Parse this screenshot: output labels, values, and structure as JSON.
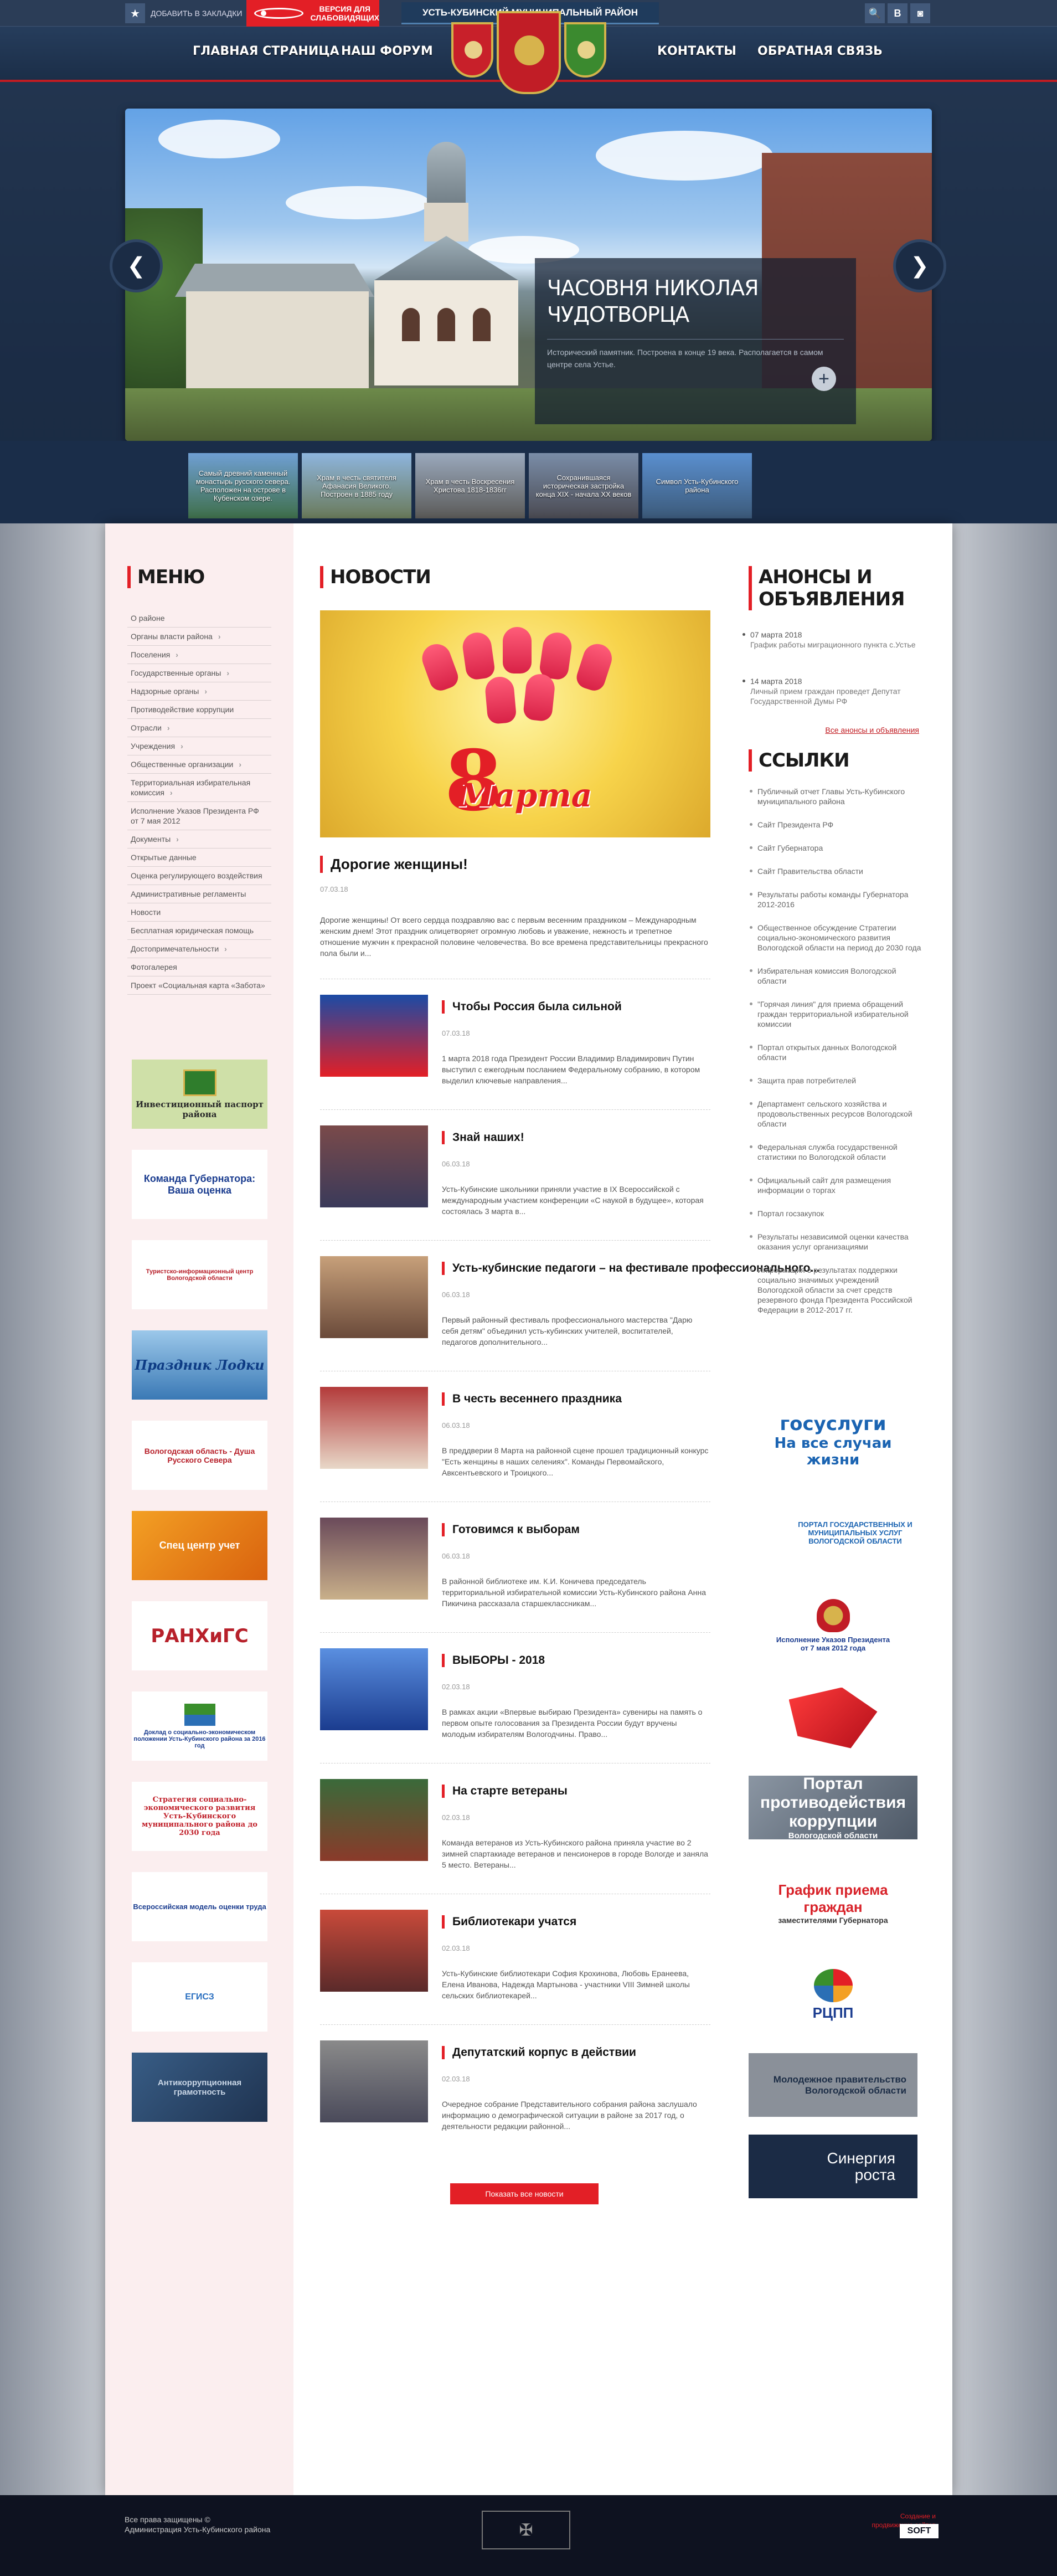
{
  "topbar": {
    "bookmark_label": "Добавить в закладки",
    "vision_label": "Версия для слабовидящих",
    "ribbon_title": "Усть-Кубинский муниципальный район",
    "social": [
      "🔍",
      "В",
      "◙"
    ]
  },
  "nav": {
    "items": [
      "Главная страница",
      "Наш форум",
      "Контакты",
      "Обратная связь"
    ]
  },
  "slider": {
    "title": "Часовня Николая Чудотворца",
    "text": "Исторический памятник. Построена в конце 19 века. Располагается в самом центре села Устье.",
    "prev": "❮",
    "next": "❯",
    "plus": "+"
  },
  "thumbs": [
    "Самый древний каменный монастырь русского севера. Расположен на острове в Кубенском озере.",
    "Храм в честь святителя Афанасия Великого. Построен в 1885 году",
    "Храм в честь Воскресения Христова 1818-1836гг",
    "Сохранившаяся историческая застройка конца XIX - начала XX веков",
    "Символ Усть-Кубинского района"
  ],
  "menu": {
    "title": "Меню",
    "items": [
      {
        "label": "О районе",
        "has_sub": false
      },
      {
        "label": "Органы власти района",
        "has_sub": true
      },
      {
        "label": "Поселения",
        "has_sub": true
      },
      {
        "label": "Государственные органы",
        "has_sub": true
      },
      {
        "label": "Надзорные органы",
        "has_sub": true
      },
      {
        "label": "Противодействие коррупции",
        "has_sub": false
      },
      {
        "label": "Отрасли",
        "has_sub": true
      },
      {
        "label": "Учреждения",
        "has_sub": true
      },
      {
        "label": "Общественные организации",
        "has_sub": true
      },
      {
        "label": "Территориальная избирательная комиссия",
        "has_sub": true
      },
      {
        "label": "Исполнение Указов Президента РФ от 7 мая 2012",
        "has_sub": false
      },
      {
        "label": "Документы",
        "has_sub": true
      },
      {
        "label": "Открытые данные",
        "has_sub": false
      },
      {
        "label": "Оценка регулирующего воздействия",
        "has_sub": false
      },
      {
        "label": "Административные регламенты",
        "has_sub": false
      },
      {
        "label": "Новости",
        "has_sub": false
      },
      {
        "label": "Бесплатная юридическая помощь",
        "has_sub": false
      },
      {
        "label": "Достопримечательности",
        "has_sub": true
      },
      {
        "label": "Фотогалерея",
        "has_sub": false
      },
      {
        "label": "Проект «Социальная карта «Забота»",
        "has_sub": false
      }
    ]
  },
  "left_banners": [
    "Инвестиционный паспорт района",
    "Команда Губернатора: Ваша оценка",
    "Туристско-информационный центр Вологодской области",
    "Праздник Лодки",
    "Вологодская область - Душа Русского Севера",
    "Спец центр учет",
    "РАНХиГС",
    "Доклад о социально-экономическом положении Усть-Кубинского района за 2016 год",
    "Стратегия социально-экономического развития Усть-Кубинского муниципального района до 2030 года",
    "Всероссийская модель оценки труда",
    "ЕГИСЗ",
    "Антикоррупционная грамотность"
  ],
  "news": {
    "title": "Новости",
    "featured": {
      "banner": "Марта",
      "banner_num": "8",
      "title": "Дорогие женщины!",
      "date": "07.03.18",
      "text": "Дорогие женщины! От всего сердца поздравляю вас с первым весенним праздником – Международным женским днем! Этот праздник олицетворяет огромную любовь и уважение, нежность и трепетное отношение мужчин к прекрасной половине человечества. Во все времена представительницы прекрасного пола были и..."
    },
    "items": [
      {
        "title": "Чтобы Россия была сильной",
        "date": "07.03.18",
        "text": "1 марта 2018 года Президент России Владимир Владимирович Путин выступил с ежегодным посланием Федеральному собранию, в котором выделил ключевые направления..."
      },
      {
        "title": "Знай наших!",
        "date": "06.03.18",
        "text": "Усть-Кубинские школьники приняли участие в IX Всероссийской с международным участием конференции «С наукой в будущее», которая состоялась 3 марта в..."
      },
      {
        "title": "Усть-кубинские педагоги – на фестивале профессионального...",
        "date": "06.03.18",
        "text": "Первый районный фестиваль профессионального мастерства \"Дарю себя детям\" объединил усть-кубинских учителей, воспитателей, педагогов дополнительного..."
      },
      {
        "title": "В честь весеннего праздника",
        "date": "06.03.18",
        "text": "В преддверии 8 Марта на районной сцене прошел традиционный конкурс \"Есть женщины в наших селениях\". Команды Первомайского, Авксентьевского и Троицкого..."
      },
      {
        "title": "Готовимся к выборам",
        "date": "06.03.18",
        "text": "В районной библиотеке им. К.И. Коничева председатель территориальной избирательной комиссии Усть-Кубинского района Анна Пикичина рассказала старшеклассникам..."
      },
      {
        "title": "ВЫБОРЫ - 2018",
        "date": "02.03.18",
        "text": "В рамках акции «Впервые выбираю Президента» сувениры на память о первом опыте голосования за Президента России будут вручены молодым избирателям Вологодчины. Право..."
      },
      {
        "title": "На старте ветераны",
        "date": "02.03.18",
        "text": "Команда ветеранов из Усть-Кубинского района приняла участие во 2 зимней спартакиаде ветеранов и пенсионеров в городе Вологде и заняла 5 место. Ветераны..."
      },
      {
        "title": "Библиотекари учатся",
        "date": "02.03.18",
        "text": "Усть-Кубинские библиотекари София Крохинова, Любовь Еранеева, Елена Иванова, Надежда Мартынова - участники VIII Зимней школы сельских библиотекарей..."
      },
      {
        "title": "Депутатский корпус в действии",
        "date": "02.03.18",
        "text": "Очередное собрание Представительного собрания района заслушало информацию о демографической ситуации в районе за 2017 год, о деятельности редакции районной..."
      }
    ],
    "show_all": "Показать все новости"
  },
  "announcements": {
    "title": "Анонсы и объявления",
    "items": [
      {
        "date": "07 марта 2018",
        "text": "График работы миграционного пункта с.Устье"
      },
      {
        "date": "14 марта 2018",
        "text": "Личный прием граждан проведет Депутат Государственной Думы РФ"
      }
    ],
    "all_link": "Все анонсы и объявления"
  },
  "links": {
    "title": "Ссылки",
    "items": [
      "Публичный отчет Главы Усть-Кубинского муниципального района",
      "Сайт Президента РФ",
      "Сайт Губернатора",
      "Сайт Правительства области",
      "Результаты работы команды Губернатора 2012-2016",
      "Общественное обсуждение Стратегии социально-экономического развития Вологодской области на период до 2030 года",
      "Избирательная комиссия Вологодской области",
      "\"Горячая линия\" для приема обращений граждан территориальной избирательной комиссии",
      "Портал открытых данных Вологодской области",
      "Защита прав потребителей",
      "Департамент сельского хозяйства и продовольственных ресурсов Вологодской области",
      "Федеральная служба государственной статистики по Вологодской области",
      "Официальный сайт для размещения информации о торгах",
      "Портал госзакупок",
      "Результаты независимой оценки качества оказания услуг организациями",
      "Информация о результатах поддержки социально значимых учреждений Вологодской области за счет средств резервного фонда Президента Российской Федерации в 2012-2017 гг."
    ]
  },
  "right_banners": [
    {
      "line1": "госуслуги",
      "line2": "На все случаи жизни"
    },
    {
      "line1": "Портал государственных и муниципальных услуг",
      "line2": "Вологодской области"
    },
    {
      "line1": "Исполнение Указов Президента",
      "line2": "от 7 мая 2012 года"
    },
    {
      "line1": "",
      "line2": ""
    },
    {
      "line1": "Портал противодействия коррупции",
      "line2": "Вологодской области"
    },
    {
      "line1": "График приема граждан",
      "line2": "заместителями Губернатора"
    },
    {
      "line1": "РЦПП",
      "line2": ""
    },
    {
      "line1": "Молодежное правительство",
      "line2": "Вологодской области"
    },
    {
      "line1": "Синергия",
      "line2": "роста"
    }
  ],
  "footer": {
    "copyright": "Все права защищены ©",
    "org": "Администрация Усть-Кубинского района",
    "dev_line1": "Создание и",
    "dev_line2": "продвижение сайтов",
    "dev_logo": "SOFT"
  }
}
